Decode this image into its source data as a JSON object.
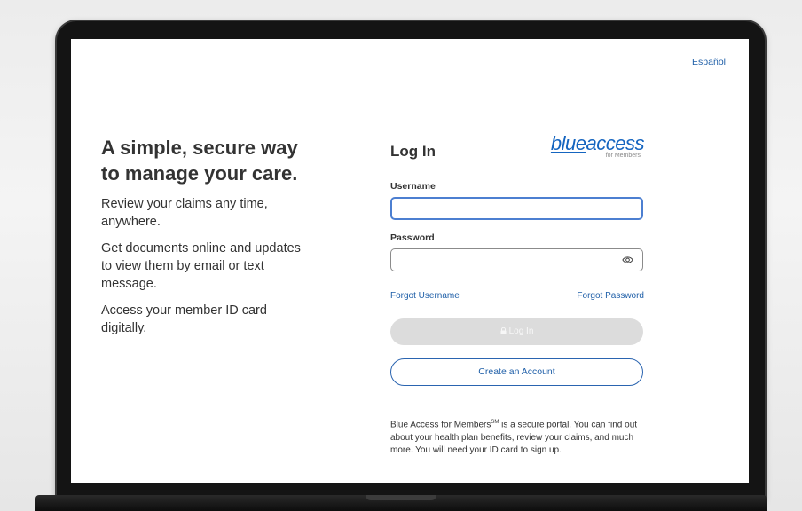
{
  "left": {
    "headline": "A simple, secure way to manage your care.",
    "bullets": [
      "Review your claims any time, anywhere.",
      "Get documents online and updates to view them by email or text message.",
      "Access your member ID card digitally."
    ]
  },
  "header": {
    "language_link": "Español"
  },
  "form": {
    "title": "Log In",
    "logo": {
      "main_part1": "blue",
      "main_part2": "access",
      "sub": "for Members"
    },
    "username_label": "Username",
    "username_value": "",
    "password_label": "Password",
    "password_value": "",
    "forgot_username": "Forgot Username",
    "forgot_password": "Forgot Password",
    "login_button": "Log In",
    "login_icon": "lock-icon",
    "create_account": "Create an Account",
    "info_part1": "Blue Access for Members",
    "info_sup": "SM",
    "info_part2": " is a secure portal. You can find out about your health plan benefits, review your claims, and much more. You will need your ID card to sign up."
  },
  "colors": {
    "accent": "#1f5fa8",
    "focus_border": "#4c7fd1",
    "disabled_button": "#dcdcdc"
  }
}
